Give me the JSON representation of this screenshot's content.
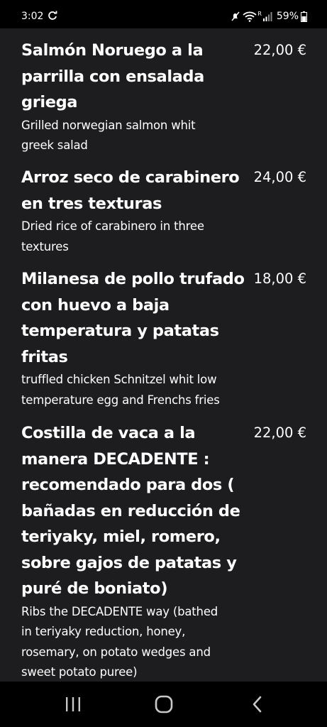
{
  "status_bar": {
    "time": "3:02",
    "battery": "59%",
    "network_label": "R"
  },
  "menu": {
    "items": [
      {
        "name_lines": [
          "Salmón Noruego a la",
          "parrilla con ensalada",
          "griega"
        ],
        "desc_lines": [
          "Grilled norwegian salmon whit",
          "greek salad"
        ],
        "price": "22,00 €"
      },
      {
        "name_lines": [
          "Arroz seco de carabinero",
          "en tres texturas"
        ],
        "desc_lines": [
          "Dried rice of carabinero in three",
          "textures"
        ],
        "price": "24,00 €"
      },
      {
        "name_lines": [
          "Milanesa de pollo trufado",
          "con huevo a baja",
          "temperatura y patatas",
          "fritas"
        ],
        "desc_lines": [
          "truffled chicken Schnitzel whit low",
          "temperature egg and Frenchs fries"
        ],
        "price": "18,00 €"
      },
      {
        "name_lines": [
          "Costilla de vaca a la",
          "manera DECADENTE :",
          "recomendado para dos (",
          "bañadas en reducción de",
          "teriyaky, miel, romero,",
          "sobre gajos de patatas y",
          "puré de boniato)"
        ],
        "desc_lines": [
          "Ribs the DECADENTE way (bathed",
          "in teriyaky reduction, honey,",
          "rosemary, on potato wedges and",
          "sweet potato puree)"
        ],
        "price": "22,00 €"
      }
    ]
  },
  "nav_bar": {
    "recents_icon": "recents-icon",
    "home_icon": "home-icon",
    "back_icon": "back-icon"
  },
  "colors": {
    "background": "#1d1d1f",
    "bars": "#000000",
    "text": "#ffffff"
  }
}
